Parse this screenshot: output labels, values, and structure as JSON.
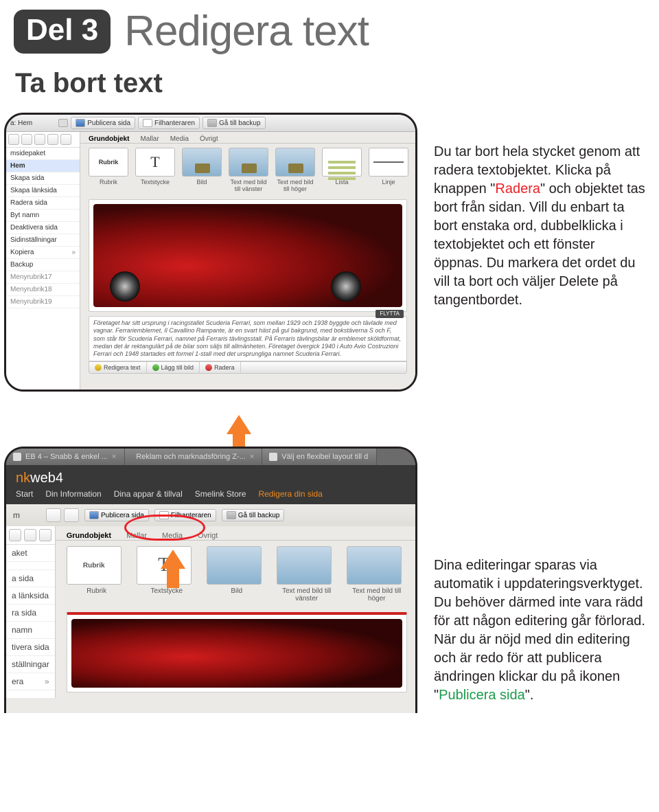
{
  "header": {
    "badge": "Del 3",
    "title": "Redigera text",
    "subtitle": "Ta bort text"
  },
  "para1": {
    "pre": "Du tar bort hela stycket genom att radera textobjektet. Klicka på knappen \"",
    "accent": "Radera",
    "post": "\" och objektet tas bort från sidan. Vill du enbart ta bort enstaka ord, dubbelklicka i textobjektet och ett fönster öppnas. Du markera det ordet du vill ta bort och väljer Delete på tangentbordet."
  },
  "para2": {
    "pre": "Dina editeringar sparas via automatik i uppdateringsverktyget. Du behöver därmed inte vara rädd för att någon editering går förlorad. När du är nöjd med din editering och är redo för att publicera ändringen klickar du på ikonen \"",
    "accent": "Publicera sida",
    "post": "\"."
  },
  "fig1": {
    "breadcrumb": "a: Hem",
    "toolbar": {
      "publicera": "Publicera sida",
      "filhanteraren": "Filhanteraren",
      "backup": "Gå till backup"
    },
    "sidebar": {
      "group": "msidepaket",
      "active": "Hem",
      "items": [
        "Skapa sida",
        "Skapa länksida",
        "Radera sida",
        "Byt namn",
        "Deaktivera sida",
        "Sidinställningar",
        "Kopiera",
        "Backup"
      ],
      "subs": [
        "Menyrubrik17",
        "Menyrubrik18",
        "Menyrubrik19"
      ]
    },
    "tabs": [
      "Grundobjekt",
      "Mallar",
      "Media",
      "Övrigt"
    ],
    "thumbs": [
      "Rubrik",
      "Textstycke",
      "Bild",
      "Text med bild till vänster",
      "Text med bild till höger",
      "Lista",
      "Linje"
    ],
    "flytta": "FLYTTA",
    "lorem": "Företaget har sitt ursprung i racingstallet Scuderia Ferrari, som mellan 1929 och 1938 byggde och tävlade med vagnar. Ferrariemblemet, Il Cavallino Rampante, är en svart häst på gul bakgrund, med bokstäverna S och F, som står för Scuderia Ferrari, namnet på Ferraris tävlingsstall. På Ferraris tävlingsbilar är emblemet sköldformat, medan det är rektangulärt på de bilar som säljs till allmänheten. Företaget övergick 1940 i Auto Avio Costruzioni Ferrari och 1948 startades ett formel 1-stall med det ursprungliga namnet Scuderia Ferrari.",
    "editbar": {
      "redigera": "Redigera text",
      "lagg": "Lägg till bild",
      "radera": "Radera"
    }
  },
  "fig2": {
    "tabs": [
      "EB 4 – Snabb & enkel ...",
      "Reklam och marknadsföring Z-...",
      "Välj en flexibel layout till d"
    ],
    "logo_a": "nk",
    "logo_b": "web",
    "logo_c": "4",
    "nav": [
      "Start",
      "Din Information",
      "Dina appar & tillval",
      "Smelink Store",
      "Redigera din sida"
    ],
    "toolbar": {
      "publicera": "Publicera sida",
      "filhanteraren": "Filhanteraren",
      "backup": "Gå till backup"
    },
    "tabs2": [
      "Grundobjekt",
      "Mallar",
      "Media",
      "Övrigt"
    ],
    "thumbs": [
      "Rubrik",
      "Textstycke",
      "Bild",
      "Text med bild till vänster",
      "Text med bild till höger"
    ],
    "sidebar": [
      "aket",
      "a sida",
      "a länksida",
      "ra sida",
      "namn",
      "tivera sida",
      "ställningar",
      "era"
    ],
    "m_label": "m"
  }
}
